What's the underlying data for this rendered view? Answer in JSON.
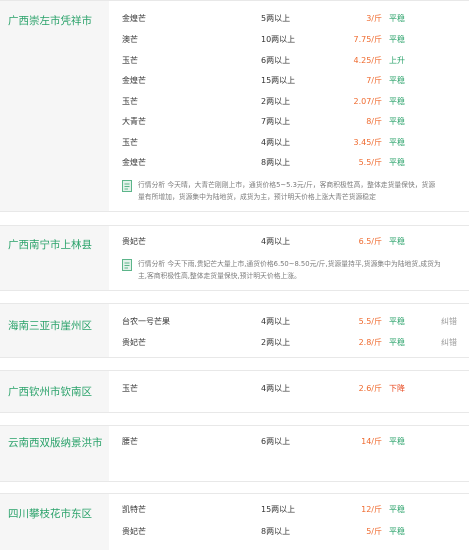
{
  "markets": [
    {
      "region": "广西崇左市凭祥市",
      "rows": [
        {
          "variety": "金煌芒",
          "spec": "5两以上",
          "price": "3/斤",
          "trend": "平稳",
          "trend_type": "flat"
        },
        {
          "variety": "澳芒",
          "spec": "10两以上",
          "price": "7.75/斤",
          "trend": "平稳",
          "trend_type": "flat"
        },
        {
          "variety": "玉芒",
          "spec": "6两以上",
          "price": "4.25/斤",
          "trend": "上升",
          "trend_type": "up"
        },
        {
          "variety": "金煌芒",
          "spec": "15两以上",
          "price": "7/斤",
          "trend": "平稳",
          "trend_type": "flat"
        },
        {
          "variety": "玉芒",
          "spec": "2两以上",
          "price": "2.07/斤",
          "trend": "平稳",
          "trend_type": "flat"
        },
        {
          "variety": "大青芒",
          "spec": "7两以上",
          "price": "8/斤",
          "trend": "平稳",
          "trend_type": "flat"
        },
        {
          "variety": "玉芒",
          "spec": "4两以上",
          "price": "3.45/斤",
          "trend": "平稳",
          "trend_type": "flat"
        },
        {
          "variety": "金煌芒",
          "spec": "8两以上",
          "price": "5.5/斤",
          "trend": "平稳",
          "trend_type": "flat"
        }
      ],
      "analysis_line1": "行情分析 今天晴，大青芒刚刚上市，通货价格5~5.3元/斤，客商积极性高，整体走货量保快，货源",
      "analysis_line2": "量有所增加，货源集中为陆地货，成货为主，预计明天价格上涨大青芒货源稳定"
    },
    {
      "region": "广西南宁市上林县",
      "rows": [
        {
          "variety": "贵妃芒",
          "spec": "4两以上",
          "price": "6.5/斤",
          "trend": "平稳",
          "trend_type": "flat"
        }
      ],
      "analysis_line1": "行情分析 今天下雨,贵妃芒大量上市,通货价格6.50~8.50元/斤,货源量持平,货源集中为陆地货,成货为",
      "analysis_line2": "主,客商积极性高,整体走货量保快,预计明天价格上涨。"
    },
    {
      "region": "海南三亚市崖州区",
      "rows": [
        {
          "variety": "台农一号芒果",
          "spec": "4两以上",
          "price": "5.5/斤",
          "trend": "平稳",
          "trend_type": "flat",
          "tag": "纠错"
        },
        {
          "variety": "贵妃芒",
          "spec": "2两以上",
          "price": "2.8/斤",
          "trend": "平稳",
          "trend_type": "flat",
          "tag": "纠错"
        }
      ]
    },
    {
      "region": "广西钦州市钦南区",
      "rows": [
        {
          "variety": "玉芒",
          "spec": "4两以上",
          "price": "2.6/斤",
          "trend": "下降",
          "trend_type": "down"
        }
      ]
    },
    {
      "region": "云南西双版纳景洪市",
      "rows": [
        {
          "variety": "腰芒",
          "spec": "6两以上",
          "price": "14/斤",
          "trend": "平稳",
          "trend_type": "flat"
        }
      ]
    },
    {
      "region": "四川攀枝花市东区",
      "rows": [
        {
          "variety": "凯特芒",
          "spec": "15两以上",
          "price": "12/斤",
          "trend": "平稳",
          "trend_type": "flat"
        },
        {
          "variety": "贵妃芒",
          "spec": "8两以上",
          "price": "5/斤",
          "trend": "平稳",
          "trend_type": "flat"
        }
      ]
    }
  ],
  "icons": {
    "analysis": "note-icon"
  },
  "colors": {
    "region": "#2aa26a",
    "price": "#ef6a2e",
    "trend_flat": "#2aa26a",
    "trend_down": "#e8481f",
    "region_bg": "#f6f6f6"
  }
}
